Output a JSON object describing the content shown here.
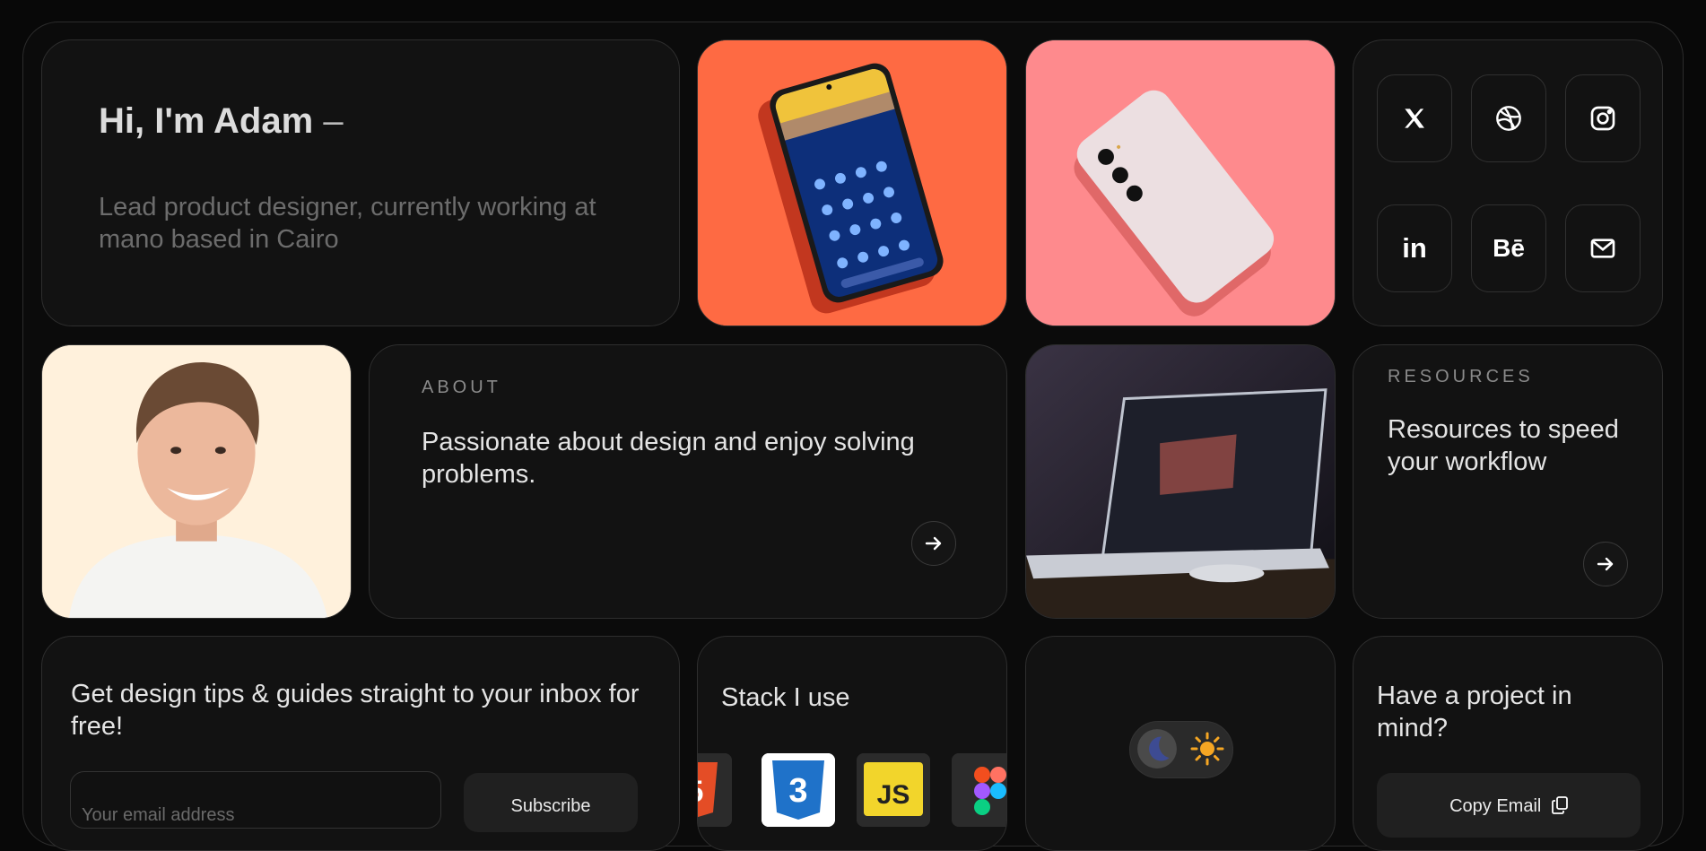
{
  "intro": {
    "title": "Hi, I'm Adam",
    "dash": "–",
    "subtitle": "Lead product designer, currently working at mano based in Cairo"
  },
  "social": [
    {
      "icon": "x-icon",
      "label": ""
    },
    {
      "icon": "dribbble-icon",
      "label": ""
    },
    {
      "icon": "instagram-icon",
      "label": ""
    },
    {
      "icon": "linkedin-icon",
      "label": "in"
    },
    {
      "icon": "behance-icon",
      "label": "Bē"
    },
    {
      "icon": "mail-icon",
      "label": ""
    }
  ],
  "about": {
    "eyebrow": "ABOUT",
    "text": "Passionate about design and enjoy solving problems."
  },
  "resources": {
    "eyebrow": "RESOURCES",
    "text": "Resources to speed your workflow"
  },
  "newsletter": {
    "title": "Get design tips & guides straight to your inbox for free!",
    "placeholder": "Your email address",
    "button": "Subscribe"
  },
  "stack": {
    "title": "Stack I use",
    "logos": [
      "html5-icon",
      "css3-icon",
      "js-icon",
      "figma-icon"
    ],
    "js_label": "JS",
    "css_label": "3"
  },
  "contact": {
    "title": "Have a project in mind?",
    "button": "Copy Email"
  },
  "colors": {
    "background": "#080808",
    "card": "#121212",
    "orange_tile": "#fe6a43",
    "pink_tile": "#fe8a8d",
    "portrait_bg": "#fff1dc",
    "sun": "#f5a623",
    "css_blue": "#1f72c9",
    "js_yellow": "#f2d52b"
  }
}
